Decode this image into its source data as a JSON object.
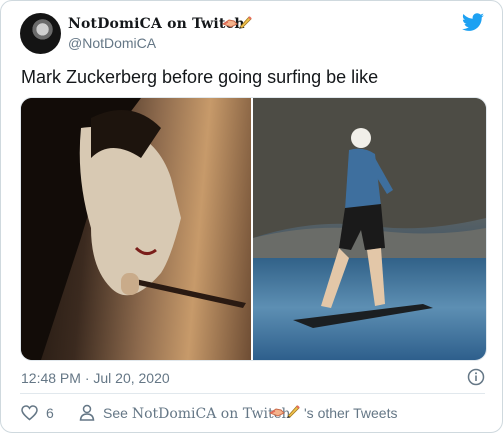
{
  "tweet": {
    "display_name": "NotDomiCA on Twitch",
    "handle": "@NotDomiCA",
    "text": "Mark Zuckerberg before going surfing be like",
    "timestamp": "12:48 PM · Jul 20, 2020",
    "likes_count": "6",
    "footer_prefix": "See",
    "footer_name": "NotDomiCA on Twitch",
    "footer_suffix": "'s other Tweets"
  },
  "colors": {
    "brand": "#1da1f2",
    "heart": "#e0245e",
    "muted": "#657786",
    "text": "#14171a",
    "border": "#cfd9de"
  },
  "icons": [
    "twitter-bird-icon",
    "heart-icon",
    "person-icon",
    "info-icon",
    "hand-emoji-icon",
    "pencil-emoji-icon"
  ]
}
